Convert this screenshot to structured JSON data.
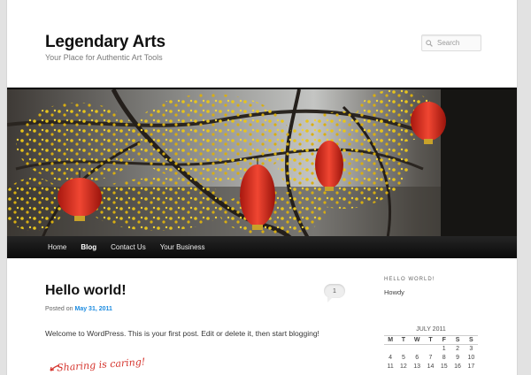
{
  "site": {
    "title": "Legendary Arts",
    "description": "Your Place for Authentic Art Tools"
  },
  "search": {
    "placeholder": "Search",
    "icon": "search-icon"
  },
  "nav": {
    "items": [
      {
        "label": "Home",
        "current": false
      },
      {
        "label": "Blog",
        "current": true
      },
      {
        "label": "Contact Us",
        "current": false
      },
      {
        "label": "Your Business",
        "current": false
      }
    ]
  },
  "post": {
    "title": "Hello world!",
    "posted_prefix": "Posted on",
    "date": "May 31, 2011",
    "comment_count": "1",
    "content": "Welcome to WordPress. This is your first post. Edit or delete it, then start blogging!",
    "sharing_text": "Sharing is caring!"
  },
  "sidebar": {
    "widget_title": "HELLO WORLD!",
    "widget_text": "Howdy",
    "calendar": {
      "caption": "JULY 2011",
      "headers": [
        "M",
        "T",
        "W",
        "T",
        "F",
        "S",
        "S"
      ],
      "rows": [
        [
          "",
          "",
          "",
          "",
          "1",
          "2",
          "3"
        ],
        [
          "4",
          "5",
          "6",
          "7",
          "8",
          "9",
          "10"
        ],
        [
          "11",
          "12",
          "13",
          "14",
          "15",
          "16",
          "17"
        ]
      ]
    }
  },
  "colors": {
    "link": "#1b8be0",
    "nav_bg": "#1a1a1a",
    "lantern": "#e23a2b",
    "blossom": "#e5c21a"
  }
}
